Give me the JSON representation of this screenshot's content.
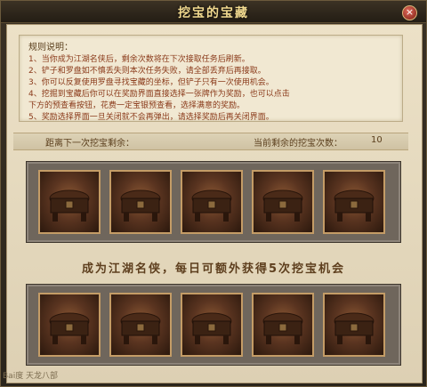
{
  "window": {
    "title": "挖宝的宝藏",
    "close_label": "×"
  },
  "rules": {
    "heading": "规则说明：",
    "lines": [
      "1、当你成为江湖名侠后，剩余次数将在下次接取任务后刷新。",
      "2、铲子和罗盘如不慎丢失则本次任务失败，请全部丢弃后再接取。",
      "3、你可以反复使用罗盘寻找宝藏的坐标，但铲子只有一次使用机会。",
      "4、挖掘到宝藏后你可以在奖励界面直接选择一张牌作为奖励，也可以点击",
      "   下方的预查看按钮，花费一定宝银预查看，选择满意的奖励。",
      "5、奖励选择界面一旦关闭就不会再弹出，请选择奖励后再关闭界面。"
    ]
  },
  "status": {
    "next_dig_label": "距离下一次挖宝剩余：",
    "remaining_label": "当前剩余的挖宝次数：",
    "remaining_value": "10"
  },
  "banner": {
    "text": "成为江湖名侠，每日可额外获得5次挖宝机会"
  },
  "watermark": {
    "text": "Bai度 天龙八部"
  }
}
